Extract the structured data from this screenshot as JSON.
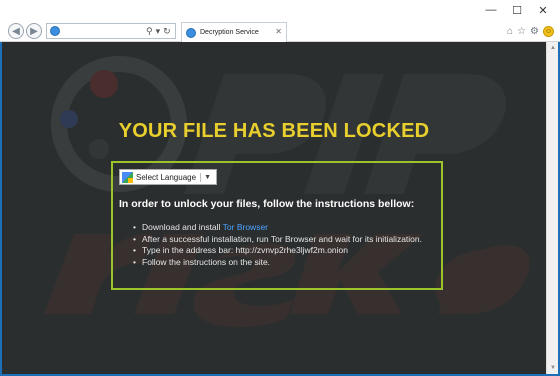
{
  "window": {
    "minimize_icon": "minimize-icon",
    "maximize_icon": "maximize-icon",
    "close_icon": "close-icon"
  },
  "nav": {
    "address_value": "",
    "tab_title": "Decryption Service",
    "tab_close": "✕",
    "icons": [
      "back-icon",
      "forward-icon",
      "search-icon",
      "refresh-icon",
      "home-icon",
      "favorites-star-icon",
      "settings-gear-icon",
      "smiley-feedback-icon"
    ]
  },
  "page": {
    "headline": "YOUR FILE HAS BEEN LOCKED",
    "language_selector": "Select Language",
    "instructions_heading": "In order to unlock your files, follow the instructions bellow:",
    "steps": {
      "step1_prefix": "Download and install ",
      "step1_link": "Tor Browser",
      "step2": "After a successful installation, run Tor Browser and wait for its initialization.",
      "step3": "Type in the address bar: http://zvnvp2rhe3ljwf2m.onion",
      "step4": "Follow the instructions on the site."
    }
  },
  "colors": {
    "headline": "#e8cf2e",
    "panel_border": "#9bc42a",
    "page_background": "#2b2e2f",
    "link": "#4aa3ff",
    "frame": "#1e6fb5"
  }
}
